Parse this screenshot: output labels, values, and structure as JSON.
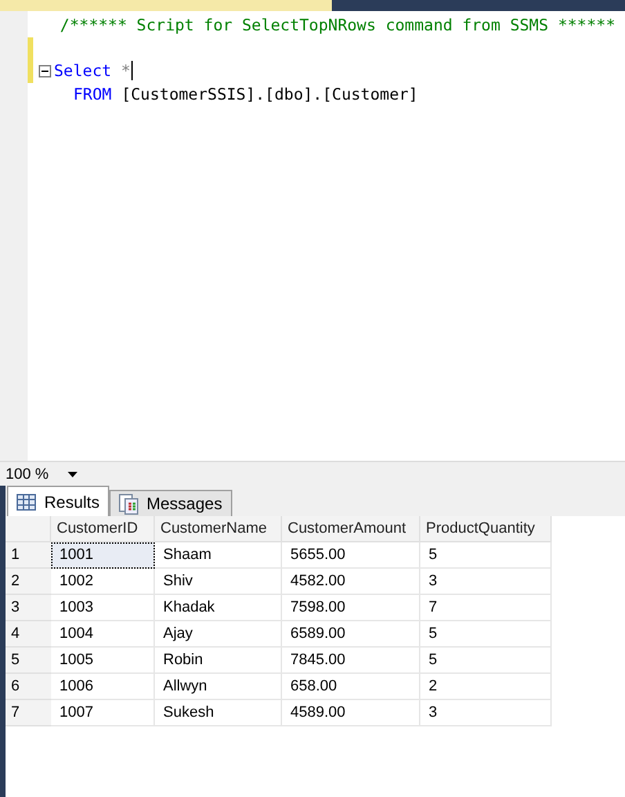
{
  "editor": {
    "lines": [
      {
        "changed": false,
        "collapsible": false,
        "indent": true,
        "tokens": [
          {
            "kind": "comment",
            "text": "/****** Script for SelectTopNRows command from SSMS  ******"
          }
        ]
      },
      {
        "changed": true,
        "collapsible": false,
        "indent": false
      },
      {
        "changed": true,
        "collapsible": true,
        "indent": false,
        "cursor": true,
        "tokens": [
          {
            "kind": "keyword",
            "text": "Select"
          },
          {
            "kind": "operator",
            "text": "*"
          }
        ]
      },
      {
        "changed": false,
        "collapsible": false,
        "indent": true,
        "tokens": [
          {
            "kind": "keyword",
            "text": "FROM"
          },
          {
            "kind": "plain",
            "text": "[CustomerSSIS].[dbo].[Customer]"
          }
        ]
      }
    ]
  },
  "zoom": {
    "value": "100 %"
  },
  "tabs": [
    {
      "label": "Results",
      "selected": true,
      "kind": "grid"
    },
    {
      "label": "Messages",
      "selected": false,
      "kind": "messages"
    }
  ],
  "table": {
    "columns": [
      "CustomerID",
      "CustomerName",
      "CustomerAmount",
      "ProductQuantity"
    ],
    "rows": [
      {
        "number": "1",
        "selected": true,
        "cells": [
          "1001",
          "Shaam",
          "5655.00",
          "5"
        ]
      },
      {
        "number": "2",
        "selected": false,
        "cells": [
          "1002",
          "Shiv",
          "4582.00",
          "3"
        ]
      },
      {
        "number": "3",
        "selected": false,
        "cells": [
          "1003",
          "Khadak",
          "7598.00",
          "7"
        ]
      },
      {
        "number": "4",
        "selected": false,
        "cells": [
          "1004",
          "Ajay",
          "6589.00",
          "5"
        ]
      },
      {
        "number": "5",
        "selected": false,
        "cells": [
          "1005",
          "Robin",
          "7845.00",
          "5"
        ]
      },
      {
        "number": "6",
        "selected": false,
        "cells": [
          "1006",
          "Allwyn",
          "658.00",
          "2"
        ]
      },
      {
        "number": "7",
        "selected": false,
        "cells": [
          "1007",
          "Sukesh",
          "4589.00",
          "3"
        ]
      }
    ]
  }
}
